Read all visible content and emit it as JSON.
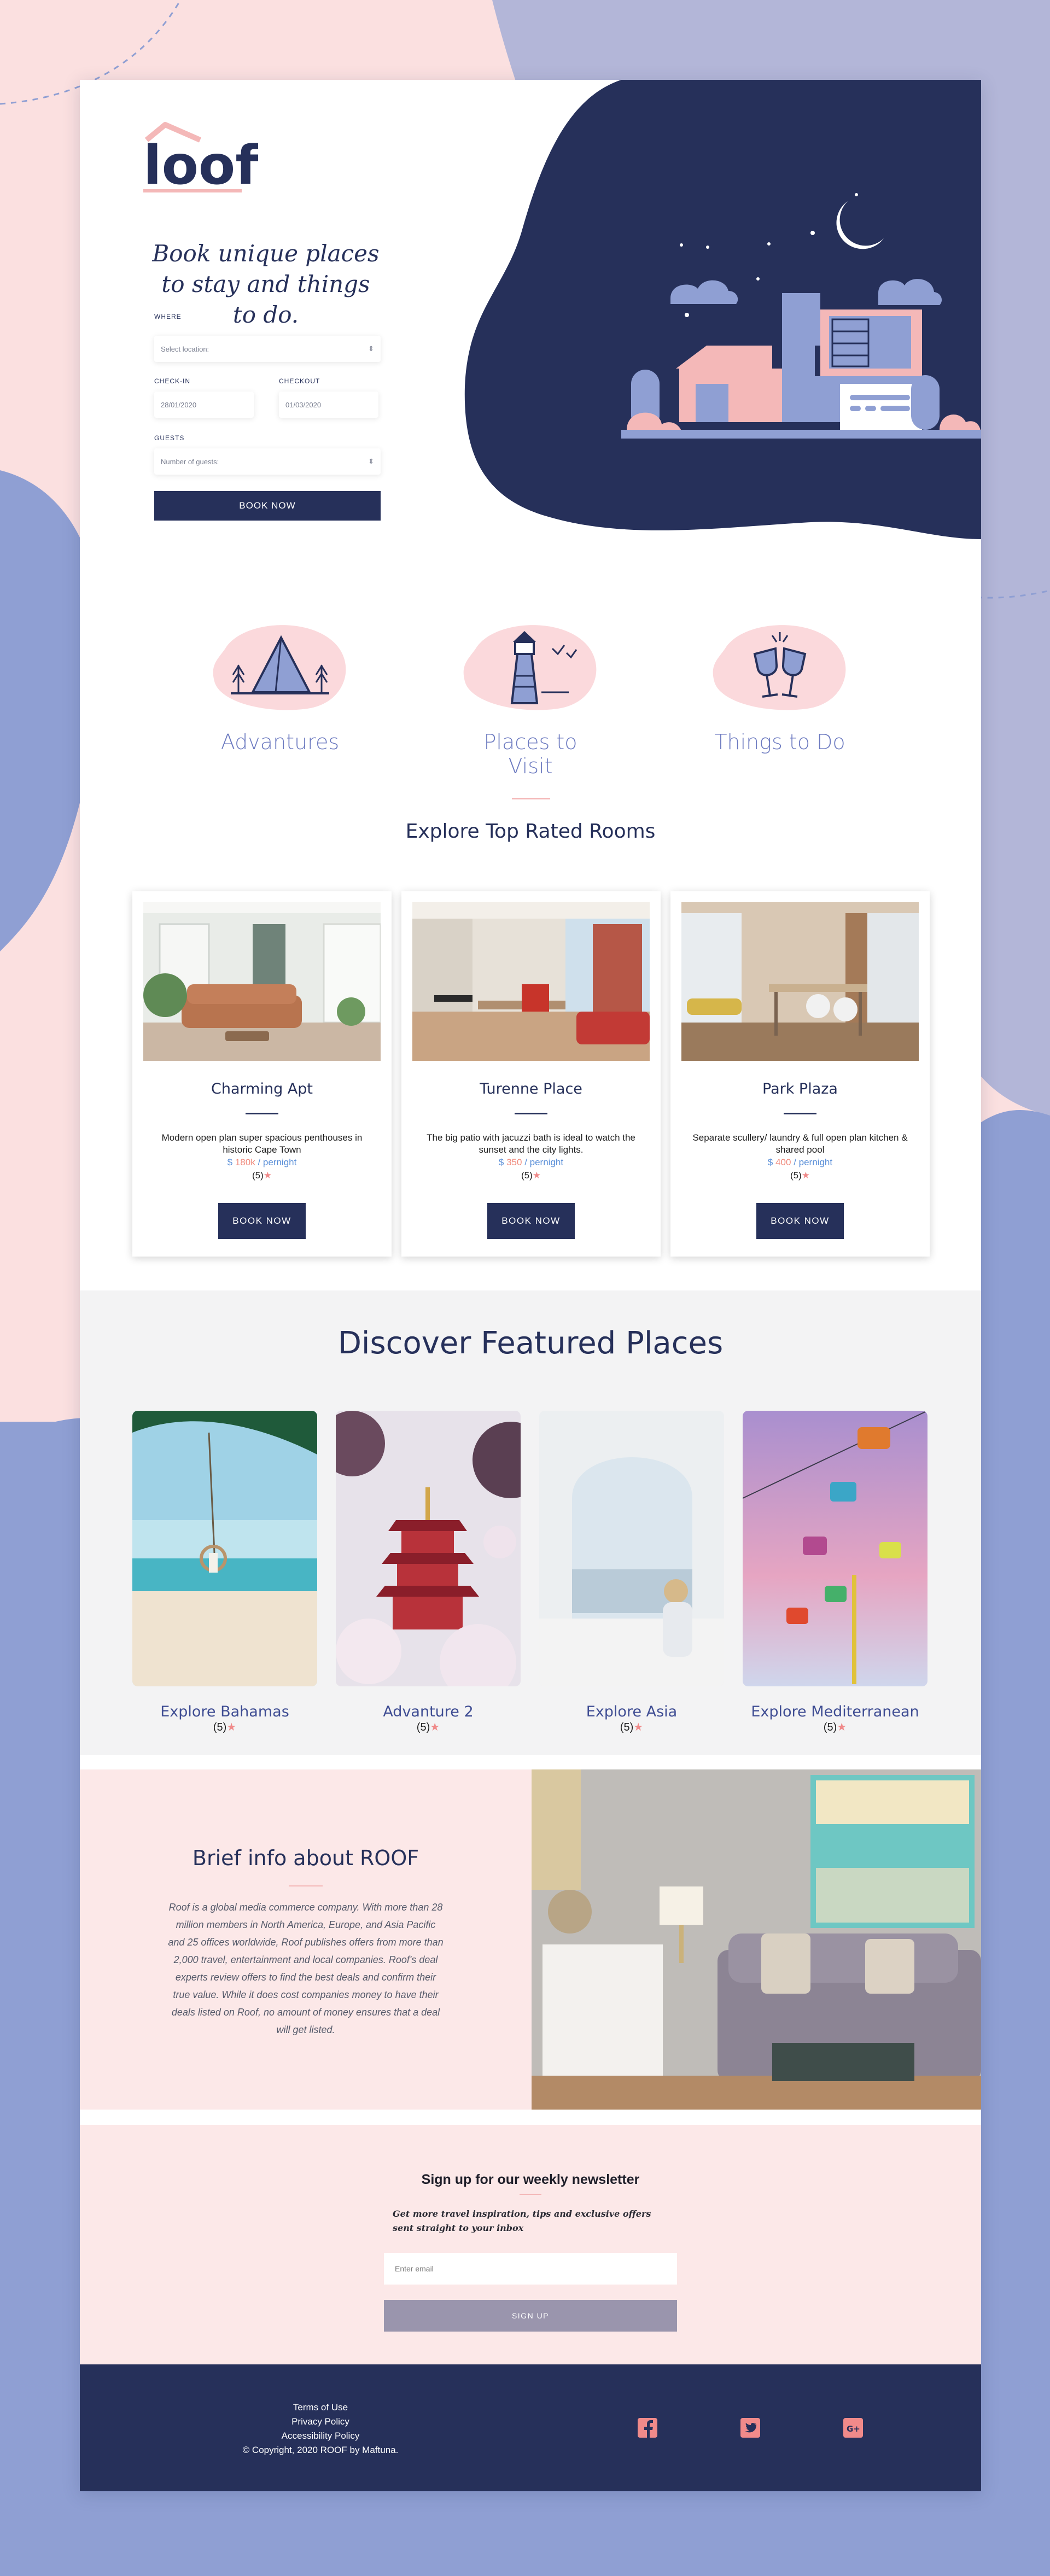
{
  "brand": {
    "logo": "loof",
    "colors": {
      "navy": "#26305a",
      "pink": "#f4b8b8",
      "periwinkle": "#8f9fd3"
    }
  },
  "hero": {
    "title": "Book unique places to stay and things to do.",
    "where_label": "WHERE",
    "where_placeholder": "Select location:",
    "checkin_label": "CHECK-IN",
    "checkin_value": "28/01/2020",
    "checkout_label": "CHECKOUT",
    "checkout_value": "01/03/2020",
    "guests_label": "GUESTS",
    "guests_placeholder": "Number of guests:",
    "book_label": "BOOK NOW"
  },
  "categories": [
    {
      "label": "Advantures",
      "icon": "tent-icon"
    },
    {
      "label": "Places to Visit",
      "icon": "lighthouse-icon"
    },
    {
      "label": "Things to Do",
      "icon": "wine-glasses-icon"
    }
  ],
  "rooms_section": {
    "title": "Explore Top Rated Rooms"
  },
  "rooms": [
    {
      "name": "Charming Apt",
      "desc": "Modern open plan super spacious penthouses in historic Cape Town",
      "currency": "$",
      "price": "180k",
      "unit": "/ pernight",
      "rating": "(5)",
      "button": "BOOK NOW"
    },
    {
      "name": "Turenne Place",
      "desc": "The big patio with jacuzzi bath is ideal to watch the sunset and the city lights.",
      "currency": "$",
      "price": "350",
      "unit": "/ pernight",
      "rating": "(5)",
      "button": "BOOK NOW"
    },
    {
      "name": "Park Plaza",
      "desc": "Separate scullery/ laundry & full open plan kitchen & shared pool",
      "currency": "$",
      "price": "400",
      "unit": "/ pernight",
      "rating": "(5)",
      "button": "BOOK NOW"
    }
  ],
  "featured": {
    "title": "Discover Featured Places",
    "places": [
      {
        "name": "Explore Bahamas",
        "rating": "(5)"
      },
      {
        "name": "Advanture 2",
        "rating": "(5)"
      },
      {
        "name": "Explore Asia",
        "rating": "(5)"
      },
      {
        "name": "Explore Mediterranean",
        "rating": "(5)"
      }
    ]
  },
  "info": {
    "title": "Brief info about ROOF",
    "text": "Roof is a global media commerce company. With more than 28 million members in North America, Europe, and Asia Pacific and 25 offices worldwide, Roof publishes offers from more than 2,000 travel, entertainment and local companies. Roof's deal experts review offers to find the best deals and confirm their true value. While it does cost companies money to have their deals listed on Roof, no amount of money ensures that a deal will get listed."
  },
  "newsletter": {
    "title": "Sign up for our weekly newsletter",
    "subtitle": "Get more travel inspiration, tips and exclusive offers sent straight to your inbox",
    "email_placeholder": "Enter email",
    "button": "SIGN UP"
  },
  "footer": {
    "terms": "Terms of Use",
    "privacy": "Privacy Policy",
    "accessibility": "Accessibility Policy",
    "copyright": "© Copyright, 2020 ROOF by Maftuna.",
    "social": [
      "facebook-icon",
      "twitter-icon",
      "google-plus-icon"
    ]
  }
}
